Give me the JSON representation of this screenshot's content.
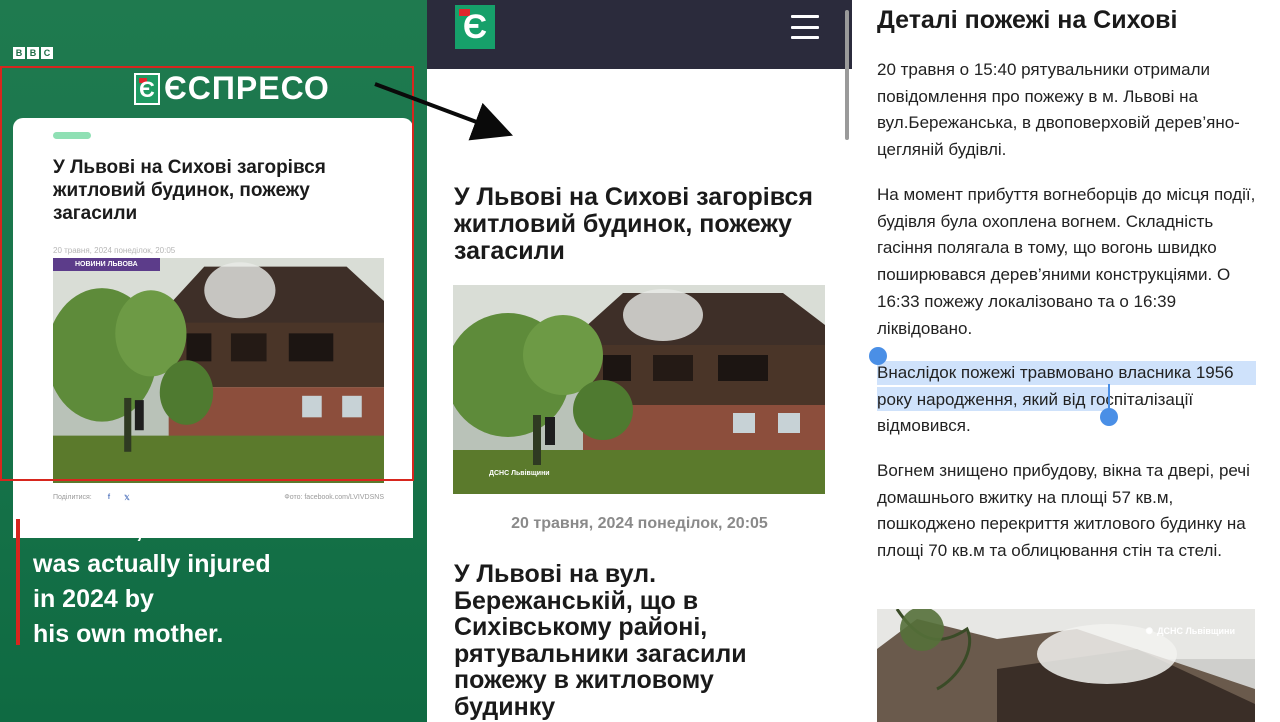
{
  "left_panel": {
    "broadcaster_logo": [
      "B",
      "B",
      "C"
    ],
    "site_logo_word": "ЄСПРЕСО",
    "article_card": {
      "title": "У Львові на Сихові загорівся житловий будинок, пожежу загасили",
      "date": "20 травня, 2024 понеділок, 20:05",
      "category_badge": "НОВИНИ ЛЬВОВА",
      "share_label": "Поділитися:",
      "share_icons": [
        "facebook-icon",
        "x-icon"
      ],
      "photo_credit": "Фото: facebook.com/LVIVDSNS"
    },
    "caption_lines": [
      "However, the child",
      "was actually injured",
      "in 2024 by",
      "his own mother."
    ]
  },
  "middle_panel": {
    "menu_icon": "hamburger-icon",
    "headline": "У Львові на Сихові загорівся житловий будинок, пожежу загасили",
    "photo_watermark": "ДСНС Львівщини",
    "date": "20 травня, 2024 понеділок, 20:05",
    "subheadline": "У Львові на вул. Бережанській, що в Сихівському районі, рятувальники загасили пожежу в житловому будинку"
  },
  "right_panel": {
    "title": "Деталі пожежі на Сихові",
    "paragraphs": [
      "20 травня о 15:40 рятувальники отримали повідомлення про пожежу в м. Львові на вул.Бережанська, в двоповерховій дерев’яно-цегляній будівлі.",
      "На момент прибуття вогнеборців до місця події, будівля була охоплена вогнем. Складність гасіння полягала в тому, що вогонь швидко поширювався дерев’яними конструкціями. О 16:33 пожежу локалізовано та о 16:39 ліквідовано.",
      "Внаслідок пожежі травмовано власника 1956 року народження, який від госпіталізації відмовився.",
      "Вогнем знищено прибудову, вікна та двері, речі домашнього вжитку на площі 57 кв.м, пошкоджено перекриття житлового будинку на площі 70 кв.м та облицювання стін та стелі."
    ],
    "photo_watermark": "ДСНС Львівщини"
  },
  "colors": {
    "espreso_green": "#16a06a",
    "bbc_frame_green": "#1f7a4f",
    "highlight_red": "#d7261e",
    "selection_blue": "#4a8fe6",
    "header_dark": "#2b2b3c"
  }
}
